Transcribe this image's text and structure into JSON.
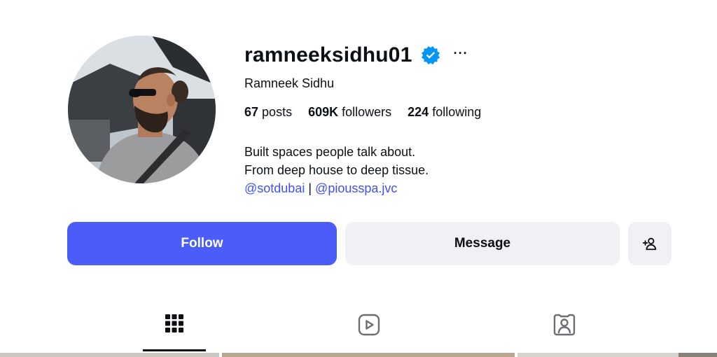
{
  "profile": {
    "username": "ramneeksidhu01",
    "verified": true,
    "more_label": "···",
    "full_name": "Ramneek Sidhu",
    "avatar_icon": "profile-photo",
    "stats": {
      "posts_count": "67",
      "posts_label": "posts",
      "followers_count": "609K",
      "followers_label": "followers",
      "following_count": "224",
      "following_label": "following"
    },
    "bio": {
      "line1": "Built spaces people talk about.",
      "line2": "From deep house to deep tissue.",
      "mention1": "@sotdubai",
      "separator": "|",
      "mention2": "@piousspa.jvc"
    }
  },
  "actions": {
    "follow_label": "Follow",
    "message_label": "Message",
    "suggest_icon": "add-person-icon"
  },
  "tabs": [
    {
      "icon": "grid-icon",
      "active": true
    },
    {
      "icon": "reels-icon",
      "active": false
    },
    {
      "icon": "tagged-icon",
      "active": false
    }
  ],
  "colors": {
    "accent": "#4a5df9",
    "link": "#4150f7",
    "verified": "#0095f6",
    "secondary_button": "#eff1f5",
    "text": "#0c1014"
  }
}
